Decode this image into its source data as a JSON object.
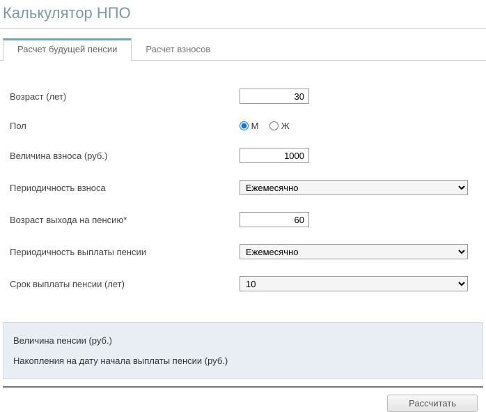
{
  "title": "Калькулятор НПО",
  "tabs": {
    "pension": "Расчет будущей пенсии",
    "contrib": "Расчет взносов"
  },
  "form": {
    "age": {
      "label": "Возраст (лет)",
      "value": "30"
    },
    "gender": {
      "label": "Пол",
      "m": "М",
      "f": "Ж"
    },
    "amount": {
      "label": "Величина взноса (руб.)",
      "value": "1000"
    },
    "freq_contrib": {
      "label": "Периодичность взноса",
      "value": "Ежемесячно"
    },
    "retire_age": {
      "label": "Возраст выхода на пенсию*",
      "value": "60"
    },
    "freq_payout": {
      "label": "Периодичность выплаты пенсии",
      "value": "Ежемесячно"
    },
    "term": {
      "label": "Срок выплаты пенсии (лет)",
      "value": "10"
    }
  },
  "results": {
    "pension_amount": "Величина пенсии (руб.)",
    "savings": "Накопления на дату начала выплаты пенсии (руб.)"
  },
  "actions": {
    "calculate": "Рассчитать"
  }
}
